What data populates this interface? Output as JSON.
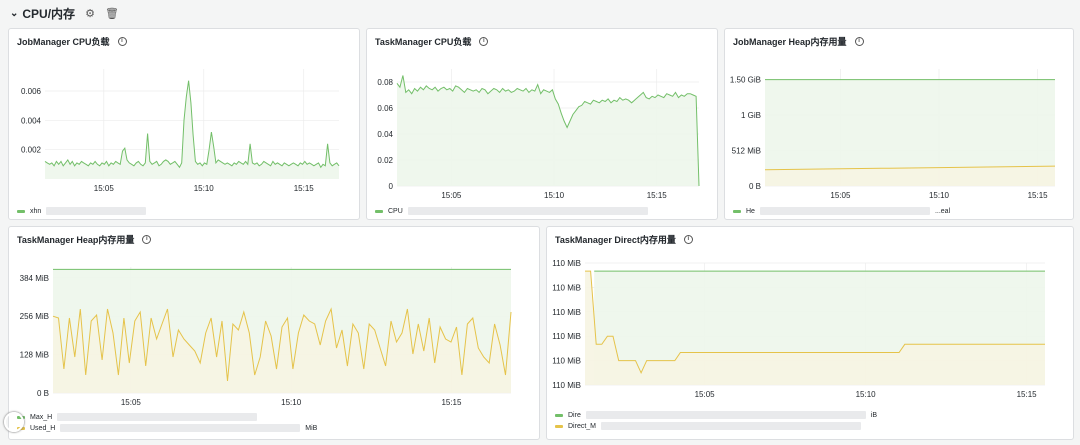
{
  "row": {
    "title": "CPU/内存",
    "settings_icon": "gear-icon",
    "delete_icon": "trash-icon"
  },
  "colors": {
    "green": "#73bf69",
    "green_fill": "#edf6eb",
    "yellow": "#e5c34a",
    "yellow_fill": "#f6f4e2",
    "grid": "#ececec"
  },
  "panels": {
    "jm_cpu": {
      "title": "JobManager CPU负载",
      "legend": [
        {
          "label": "xhn",
          "color": "#73bf69"
        }
      ]
    },
    "tm_cpu": {
      "title": "TaskManager CPU负载",
      "legend": [
        {
          "label": "CPU",
          "color": "#73bf69"
        }
      ]
    },
    "jm_heap": {
      "title": "JobManager Heap内存用量",
      "legend": [
        {
          "label": "He",
          "color": "#73bf69"
        },
        {
          "label": "...eal",
          "color": null
        }
      ]
    },
    "tm_heap": {
      "title": "TaskManager Heap内存用量",
      "legend": [
        {
          "label": "Max_H",
          "color": "#73bf69",
          "suffix": ""
        },
        {
          "label": "Used_H",
          "color": "#e5c34a",
          "suffix": "MiB"
        }
      ]
    },
    "tm_direct": {
      "title": "TaskManager Direct内存用量",
      "legend": [
        {
          "label": "Dire",
          "color": "#73bf69",
          "suffix": "iB"
        },
        {
          "label": "Direct_M",
          "color": "#e5c34a",
          "suffix": ""
        }
      ]
    }
  },
  "chart_data": [
    {
      "type": "line",
      "title": "JobManager CPU负载",
      "ylim": [
        0,
        0.0075
      ],
      "y_ticks": [
        "0.002",
        "0.004",
        "0.006"
      ],
      "x_ticks": [
        "15:05",
        "15:10",
        "15:15"
      ],
      "grid": true,
      "series": [
        {
          "name": "xhn",
          "color": "#73bf69",
          "values": [
            0.0012,
            0.0011,
            0.001,
            0.0011,
            0.0009,
            0.0012,
            0.001,
            0.0012,
            0.0009,
            0.0011,
            0.0013,
            0.001,
            0.0012,
            0.0009,
            0.0011,
            0.001,
            0.0012,
            0.0011,
            0.001,
            0.0009,
            0.0011,
            0.001,
            0.0012,
            0.001,
            0.0009,
            0.0011,
            0.001,
            0.0012,
            0.0009,
            0.0011,
            0.001,
            0.0012,
            0.0011,
            0.001,
            0.0019,
            0.0021,
            0.0013,
            0.0011,
            0.001,
            0.0009,
            0.0011,
            0.0012,
            0.001,
            0.0009,
            0.0011,
            0.0031,
            0.0012,
            0.001,
            0.0011,
            0.0012,
            0.0009,
            0.001,
            0.0012,
            0.0013,
            0.0012,
            0.001,
            0.0011,
            0.0012,
            0.001,
            0.0008,
            0.0011,
            0.004,
            0.0056,
            0.0067,
            0.0052,
            0.003,
            0.0012,
            0.001,
            0.0011,
            0.0009,
            0.0011,
            0.001,
            0.002,
            0.0032,
            0.0022,
            0.0011,
            0.0013,
            0.0012,
            0.0011,
            0.001,
            0.0011,
            0.001,
            0.0009,
            0.0011,
            0.001,
            0.0012,
            0.0011,
            0.001,
            0.0012,
            0.001,
            0.0024,
            0.0011,
            0.001,
            0.0011,
            0.0009,
            0.001,
            0.0012,
            0.0011,
            0.001,
            0.0009,
            0.0012,
            0.001,
            0.0011,
            0.001,
            0.0009,
            0.0011,
            0.001,
            0.0009,
            0.001,
            0.0011,
            0.001,
            0.0009,
            0.0011,
            0.001,
            0.0012,
            0.001,
            0.0011,
            0.001,
            0.0009,
            0.001,
            0.0011,
            0.0008,
            0.001,
            0.0009,
            0.0024,
            0.0011,
            0.0009,
            0.001,
            0.0011,
            0.0009
          ]
        }
      ]
    },
    {
      "type": "line",
      "title": "TaskManager CPU负载",
      "ylim": [
        0,
        0.09
      ],
      "y_ticks": [
        "0",
        "0.02",
        "0.04",
        "0.06",
        "0.08"
      ],
      "x_ticks": [
        "15:05",
        "15:10",
        "15:15"
      ],
      "grid": true,
      "series": [
        {
          "name": "CPU",
          "color": "#73bf69",
          "values": [
            0.079,
            0.076,
            0.085,
            0.072,
            0.074,
            0.071,
            0.075,
            0.073,
            0.076,
            0.074,
            0.077,
            0.075,
            0.074,
            0.076,
            0.073,
            0.075,
            0.076,
            0.074,
            0.075,
            0.073,
            0.077,
            0.076,
            0.074,
            0.072,
            0.075,
            0.074,
            0.073,
            0.074,
            0.072,
            0.075,
            0.074,
            0.071,
            0.073,
            0.075,
            0.074,
            0.072,
            0.075,
            0.073,
            0.074,
            0.072,
            0.073,
            0.075,
            0.074,
            0.073,
            0.075,
            0.072,
            0.074,
            0.073,
            0.078,
            0.071,
            0.074,
            0.073,
            0.072,
            0.074,
            0.067,
            0.063,
            0.056,
            0.05,
            0.045,
            0.05,
            0.055,
            0.058,
            0.061,
            0.062,
            0.065,
            0.064,
            0.063,
            0.066,
            0.065,
            0.064,
            0.066,
            0.065,
            0.067,
            0.064,
            0.066,
            0.065,
            0.068,
            0.066,
            0.067,
            0.066,
            0.064,
            0.066,
            0.068,
            0.07,
            0.072,
            0.068,
            0.067,
            0.069,
            0.068,
            0.07,
            0.069,
            0.068,
            0.071,
            0.07,
            0.069,
            0.072,
            0.068,
            0.07,
            0.069,
            0.071,
            0.071,
            0.07,
            0.069,
            0.0
          ]
        }
      ]
    },
    {
      "type": "area",
      "title": "JobManager Heap内存用量",
      "ylim": [
        0,
        1.65
      ],
      "y_ticks": [
        "0 B",
        "512 MiB",
        "1 GiB",
        "1.50 GiB"
      ],
      "x_ticks": [
        "15:05",
        "15:10",
        "15:15"
      ],
      "grid": true,
      "series": [
        {
          "name": "He",
          "color": "#73bf69",
          "values": [
            1.5,
            1.5
          ]
        },
        {
          "name": "eal",
          "color": "#e5c34a",
          "values": [
            0.23,
            0.24,
            0.25,
            0.26,
            0.27,
            0.28
          ]
        }
      ]
    },
    {
      "type": "area",
      "title": "TaskManager Heap内存用量",
      "ylim": [
        0,
        420
      ],
      "y_ticks": [
        "0 B",
        "128 MiB",
        "256 MiB",
        "384 MiB"
      ],
      "x_ticks": [
        "15:05",
        "15:10",
        "15:15"
      ],
      "grid": true,
      "series": [
        {
          "name": "Max_H",
          "color": "#73bf69",
          "values": [
            412,
            412
          ]
        },
        {
          "name": "Used_H",
          "color": "#e5c34a",
          "values": [
            256,
            250,
            80,
            250,
            120,
            280,
            60,
            240,
            260,
            110,
            280,
            200,
            60,
            250,
            100,
            240,
            270,
            90,
            250,
            180,
            230,
            280,
            120,
            210,
            180,
            160,
            140,
            100,
            200,
            250,
            120,
            240,
            40,
            230,
            210,
            270,
            200,
            60,
            120,
            240,
            190,
            80,
            220,
            250,
            80,
            200,
            260,
            240,
            230,
            160,
            240,
            280,
            150,
            210,
            90,
            230,
            200,
            80,
            230,
            210,
            150,
            90,
            240,
            170,
            200,
            280,
            130,
            230,
            140,
            250,
            100,
            220,
            180,
            170,
            220,
            60,
            230,
            250,
            150,
            120,
            100,
            230,
            160,
            60,
            270
          ]
        }
      ]
    },
    {
      "type": "area",
      "title": "TaskManager Direct内存用量",
      "ylim": [
        0,
        150
      ],
      "y_ticks": [
        "110 MiB",
        "110 MiB",
        "110 MiB",
        "110 MiB",
        "110 MiB",
        "110 MiB"
      ],
      "x_ticks": [
        "15:05",
        "15:10",
        "15:15"
      ],
      "grid": true,
      "series": [
        {
          "name": "Dire",
          "color": "#73bf69",
          "values": [
            140,
            140,
            140,
            140
          ]
        },
        {
          "name": "Direct_M",
          "color": "#e5c34a",
          "values": [
            140,
            140,
            50,
            50,
            60,
            60,
            30,
            30,
            30,
            30,
            15,
            30,
            30,
            30,
            30,
            30,
            30,
            40,
            40,
            40,
            40,
            40,
            40,
            40,
            40,
            40,
            40,
            40,
            40,
            40,
            40,
            40,
            40,
            40,
            40,
            40,
            40,
            40,
            40,
            40,
            40,
            40,
            40,
            40,
            40,
            40,
            40,
            40,
            40,
            40,
            40,
            40,
            40,
            40,
            40,
            40,
            40,
            50,
            50,
            50,
            50,
            50,
            50,
            50,
            50,
            50,
            50,
            50,
            50,
            50,
            50,
            50,
            50,
            50,
            50,
            50,
            50,
            50,
            50,
            50,
            50,
            50,
            50
          ]
        }
      ]
    }
  ]
}
